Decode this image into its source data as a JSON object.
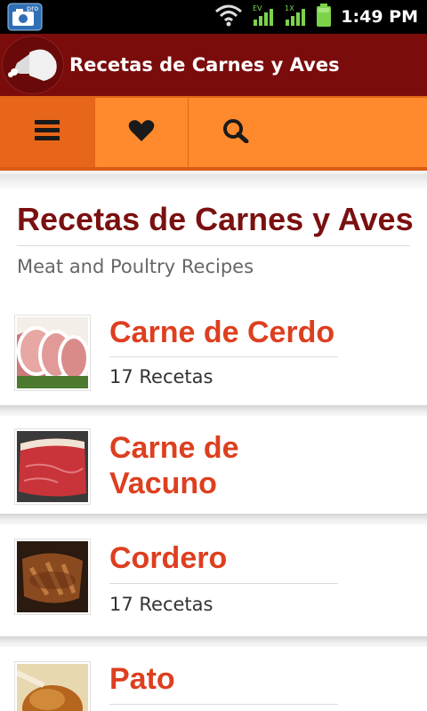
{
  "status_bar": {
    "time": "1:49 PM",
    "app_badge": "pro",
    "icons": [
      "camera-pro-icon",
      "wifi-icon",
      "signal-ev-icon",
      "signal-1x-icon",
      "battery-icon"
    ]
  },
  "header": {
    "title": "Recetas de Carnes y Aves",
    "logo_icon": "ham-leg-icon",
    "bg_color": "#7a0c0c"
  },
  "toolbar": {
    "menu_icon": "hamburger-menu-icon",
    "favorites_icon": "heart-icon",
    "search_icon": "search-icon",
    "bg_color": "#ff8a2e",
    "active_color": "#e8661a"
  },
  "main": {
    "title": "Recetas de Carnes y Aves",
    "subtitle": "Meat and Poultry Recipes",
    "title_color": "#7a1010",
    "item_color": "#dd3f1f",
    "categories": [
      {
        "name": "Carne de Cerdo",
        "count": "17 Recetas",
        "image": "pork-chops-thumbnail"
      },
      {
        "name": "Carne de Vacuno",
        "count": "",
        "image": "beef-steak-thumbnail"
      },
      {
        "name": "Cordero",
        "count": "17 Recetas",
        "image": "lamb-thumbnail"
      },
      {
        "name": "Pato",
        "count": "",
        "image": "duck-thumbnail"
      }
    ]
  }
}
